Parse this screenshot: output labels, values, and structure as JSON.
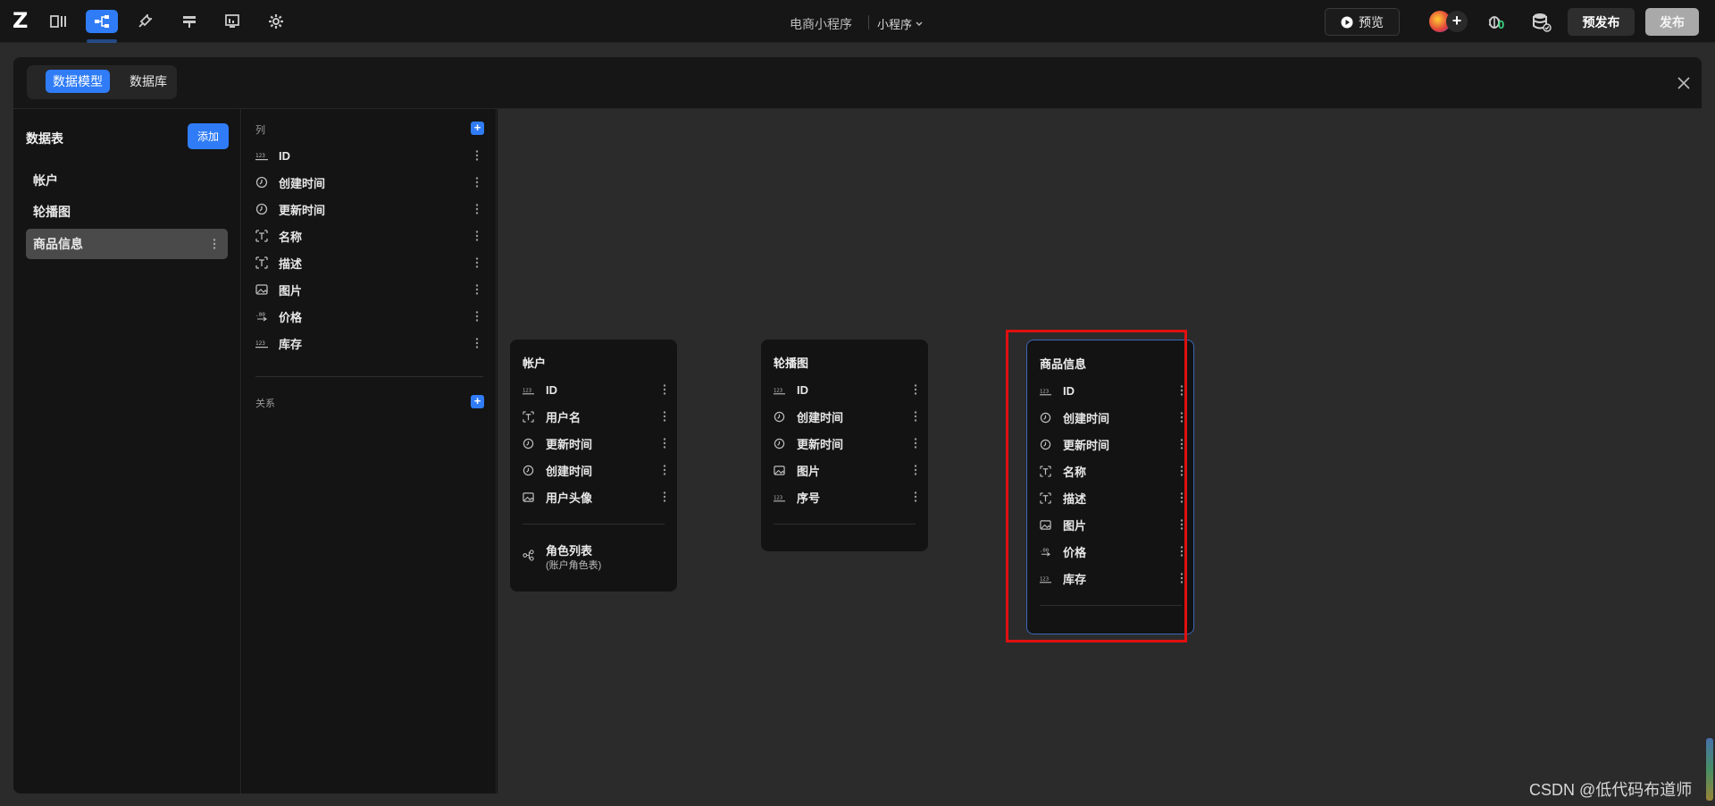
{
  "app": {
    "title": "电商小程序",
    "type_label": "小程序"
  },
  "toolbar": {
    "preview_label": "预览",
    "prepublish_label": "预发布",
    "publish_label": "发布",
    "debug_badge": "0"
  },
  "panel": {
    "tabs": [
      "数据模型",
      "数据库"
    ],
    "active_tab": "数据模型"
  },
  "tables_section": {
    "title": "数据表",
    "add_label": "添加",
    "items": [
      {
        "label": "帐户"
      },
      {
        "label": "轮播图"
      },
      {
        "label": "商品信息"
      }
    ],
    "selected": "商品信息"
  },
  "columns_section": {
    "columns_label": "列",
    "relations_label": "关系",
    "columns": [
      {
        "label": "ID",
        "icon": "number-icon"
      },
      {
        "label": "创建时间",
        "icon": "clock-icon"
      },
      {
        "label": "更新时间",
        "icon": "clock-icon"
      },
      {
        "label": "名称",
        "icon": "text-icon"
      },
      {
        "label": "描述",
        "icon": "text-icon"
      },
      {
        "label": "图片",
        "icon": "image-icon"
      },
      {
        "label": "价格",
        "icon": "decimal-icon"
      },
      {
        "label": "库存",
        "icon": "number-icon"
      }
    ]
  },
  "canvas": {
    "cards": [
      {
        "title": "帐户",
        "fields": [
          {
            "label": "ID",
            "icon": "number-icon"
          },
          {
            "label": "用户名",
            "icon": "text-icon"
          },
          {
            "label": "更新时间",
            "icon": "clock-icon"
          },
          {
            "label": "创建时间",
            "icon": "clock-icon"
          },
          {
            "label": "用户头像",
            "icon": "image-icon"
          }
        ],
        "relation": {
          "title": "角色列表",
          "subtitle": "(账户角色表)"
        }
      },
      {
        "title": "轮播图",
        "fields": [
          {
            "label": "ID",
            "icon": "number-icon"
          },
          {
            "label": "创建时间",
            "icon": "clock-icon"
          },
          {
            "label": "更新时间",
            "icon": "clock-icon"
          },
          {
            "label": "图片",
            "icon": "image-icon"
          },
          {
            "label": "序号",
            "icon": "number-icon"
          }
        ]
      },
      {
        "title": "商品信息",
        "fields": [
          {
            "label": "ID",
            "icon": "number-icon"
          },
          {
            "label": "创建时间",
            "icon": "clock-icon"
          },
          {
            "label": "更新时间",
            "icon": "clock-icon"
          },
          {
            "label": "名称",
            "icon": "text-icon"
          },
          {
            "label": "描述",
            "icon": "text-icon"
          },
          {
            "label": "图片",
            "icon": "image-icon"
          },
          {
            "label": "价格",
            "icon": "decimal-icon"
          },
          {
            "label": "库存",
            "icon": "number-icon"
          }
        ]
      }
    ]
  },
  "watermark": "CSDN @低代码布道师",
  "colors": {
    "accent": "#2f7cf6",
    "highlight_frame": "#e01010"
  }
}
